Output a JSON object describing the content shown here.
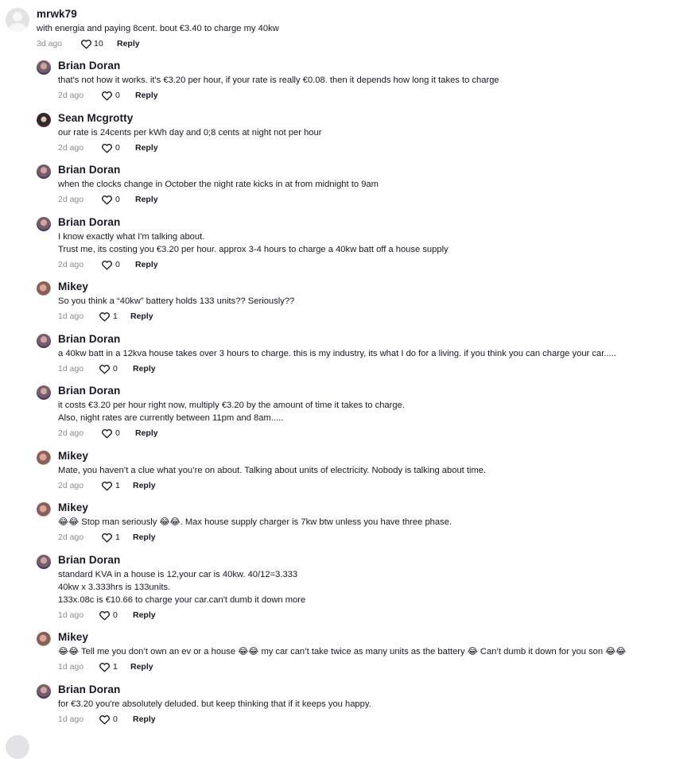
{
  "top_comment": {
    "author": "mrwk79",
    "text": "with energia and paying 8cent. bout €3.40 to charge my 40kw",
    "time": "3d ago",
    "likes": "10",
    "reply_label": "Reply"
  },
  "replies": [
    {
      "author": "Brian Doran",
      "avatar": "brian",
      "lines": [
        "that's not how it works. it's €3.20 per hour, if your rate is really €0.08. then it depends how long it takes to charge"
      ],
      "time": "2d ago",
      "likes": "0",
      "reply_label": "Reply"
    },
    {
      "author": "Sean Mcgrotty",
      "avatar": "sean",
      "lines": [
        "our rate is 24cents per kWh day and 0;8 cents at night not per hour"
      ],
      "time": "2d ago",
      "likes": "0",
      "reply_label": "Reply"
    },
    {
      "author": "Brian Doran",
      "avatar": "brian",
      "lines": [
        "when the clocks change in October the night rate kicks in at from midnight to 9am"
      ],
      "time": "2d ago",
      "likes": "0",
      "reply_label": "Reply"
    },
    {
      "author": "Brian Doran",
      "avatar": "brian",
      "lines": [
        "I know exactly what I'm talking about.",
        "Trust me, its costing you €3.20 per hour. approx 3-4 hours to charge a 40kw batt off a house supply"
      ],
      "time": "2d ago",
      "likes": "0",
      "reply_label": "Reply"
    },
    {
      "author": "Mikey",
      "avatar": "mikey",
      "lines": [
        "So you think a “40kw” battery holds 133 units?? Seriously??"
      ],
      "time": "1d ago",
      "likes": "1",
      "reply_label": "Reply"
    },
    {
      "author": "Brian Doran",
      "avatar": "brian",
      "lines": [
        "a 40kw batt in a 12kva house takes over 3 hours to charge. this is my industry, its what I do for a living. if you think you can charge your car....."
      ],
      "time": "1d ago",
      "likes": "0",
      "reply_label": "Reply"
    },
    {
      "author": "Brian Doran",
      "avatar": "brian",
      "lines": [
        "it costs €3.20 per hour right now, multiply €3.20 by the amount of time it takes to charge.",
        "Also, night rates are currently between 11pm and 8am....."
      ],
      "time": "2d ago",
      "likes": "0",
      "reply_label": "Reply"
    },
    {
      "author": "Mikey",
      "avatar": "mikey",
      "lines": [
        "Mate, you haven’t a clue what you’re on about. Talking about units of electricity. Nobody is talking about time."
      ],
      "time": "2d ago",
      "likes": "1",
      "reply_label": "Reply"
    },
    {
      "author": "Mikey",
      "avatar": "mikey",
      "lines": [
        "😂😂 Stop man seriously 😂😂. Max house supply charger is 7kw btw unless you have three phase."
      ],
      "time": "2d ago",
      "likes": "1",
      "reply_label": "Reply"
    },
    {
      "author": "Brian Doran",
      "avatar": "brian",
      "lines": [
        "standard KVA in a house is 12,your car is 40kw. 40/12=3.333",
        "40kw x 3.333hrs is 133units.",
        "133x.08c is €10.66 to charge your car.can't dumb it down more"
      ],
      "time": "1d ago",
      "likes": "0",
      "reply_label": "Reply"
    },
    {
      "author": "Mikey",
      "avatar": "mikey",
      "lines": [
        "😂😂 Tell me you don’t own an ev or a house 😂😂 my car can’t take twice as many units as the battery 😂 Can’t dumb it down for you son 😂😂"
      ],
      "time": "1d ago",
      "likes": "1",
      "reply_label": "Reply"
    },
    {
      "author": "Brian Doran",
      "avatar": "brian",
      "lines": [
        "for €3.20 you're absolutely deluded. but keep thinking that if it keeps you happy."
      ],
      "time": "1d ago",
      "likes": "0",
      "reply_label": "Reply"
    }
  ],
  "icons": {
    "like": "heart-outline-icon",
    "default_avatar": "user-silhouette-icon"
  },
  "colors": {
    "text": "#161823",
    "muted": "#8a8b91",
    "background": "#ffffff"
  }
}
